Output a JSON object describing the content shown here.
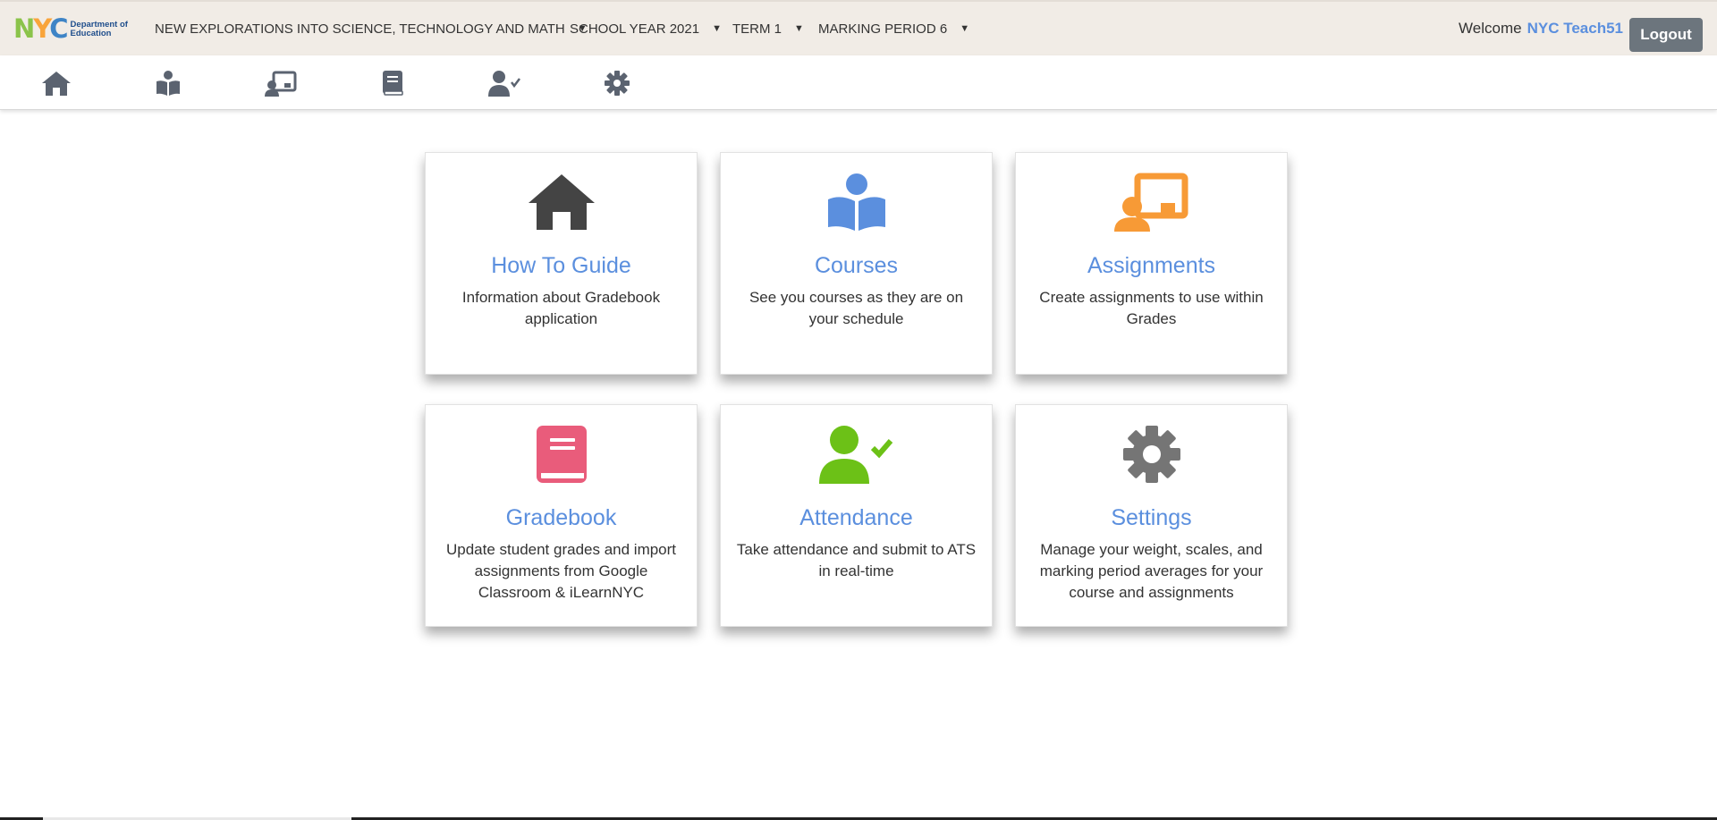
{
  "header": {
    "logo_letters": [
      "N",
      "Y",
      "C"
    ],
    "logo_dept_line1": "Department of",
    "logo_dept_line2": "Education",
    "school": "NEW EXPLORATIONS INTO SCIENCE, TECHNOLOGY AND MATH",
    "school_year": "SCHOOL YEAR 2021",
    "term": "TERM 1",
    "marking_period": "MARKING PERIOD 6",
    "welcome_label": "Welcome",
    "user_name": "NYC Teach51",
    "logout_label": "Logout"
  },
  "nav_icons": [
    "home-icon",
    "courses-icon",
    "assignments-icon",
    "gradebook-icon",
    "attendance-icon",
    "settings-icon"
  ],
  "cards": [
    {
      "title": "How To Guide",
      "desc": "Information about Gradebook application",
      "icon": "home-icon",
      "color": "#444444"
    },
    {
      "title": "Courses",
      "desc": "See you courses as they are on your schedule",
      "icon": "courses-icon",
      "color": "#5b8fde"
    },
    {
      "title": "Assignments",
      "desc": "Create assignments to use within Grades",
      "icon": "assignments-icon",
      "color": "#f79a36"
    },
    {
      "title": "Gradebook",
      "desc": "Update student grades and import assignments from Google Classroom & iLearnNYC",
      "icon": "gradebook-icon",
      "color": "#e95c7b"
    },
    {
      "title": "Attendance",
      "desc": "Take attendance and submit to ATS in real-time",
      "icon": "attendance-icon",
      "color": "#6cc117"
    },
    {
      "title": "Settings",
      "desc": "Manage your weight, scales, and marking period averages for your course and assignments",
      "icon": "settings-icon",
      "color": "#757575"
    }
  ],
  "colors": {
    "accent": "#5b8fde",
    "topbar_bg": "#f1ece6",
    "logout_bg": "#6c757d"
  }
}
